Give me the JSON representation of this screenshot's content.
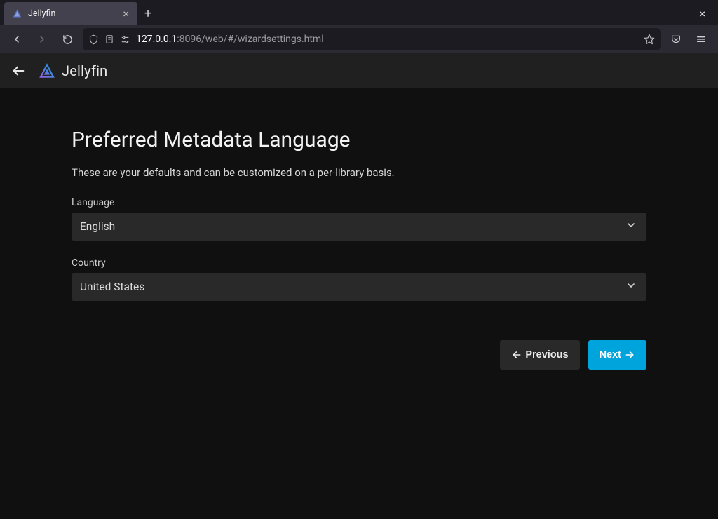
{
  "browser": {
    "tab_title": "Jellyfin",
    "url_host": "127.0.0.1",
    "url_port_path": ":8096/web/#/wizardsettings.html"
  },
  "app": {
    "logo_text": "Jellyfin"
  },
  "wizard": {
    "title": "Preferred Metadata Language",
    "subtitle": "These are your defaults and can be customized on a per-library basis.",
    "fields": {
      "language": {
        "label": "Language",
        "value": "English"
      },
      "country": {
        "label": "Country",
        "value": "United States"
      }
    },
    "buttons": {
      "previous": "Previous",
      "next": "Next"
    }
  },
  "colors": {
    "primary": "#00a4dc"
  }
}
